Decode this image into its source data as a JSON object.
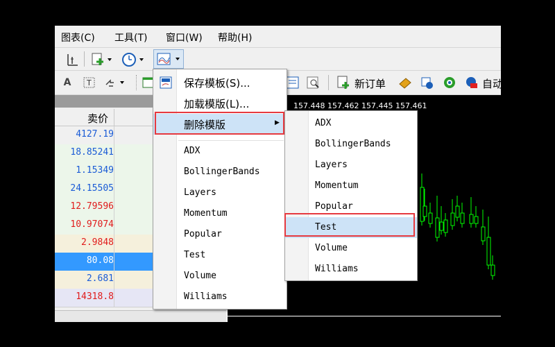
{
  "menubar": {
    "items": [
      "图表(C)",
      "工具(T)",
      "窗口(W)",
      "帮助(H)"
    ]
  },
  "toolbar2": {
    "new_order_label": "新订单",
    "auto_label": "自动"
  },
  "market_watch": {
    "column_header": "卖价",
    "rows": [
      {
        "value": "4127.19",
        "color": "#1a5bd6",
        "bg": "#f0f0f0"
      },
      {
        "value": "18.85241",
        "color": "#1a5bd6",
        "bg": "#ecf6ea"
      },
      {
        "value": "1.15349",
        "color": "#1a5bd6",
        "bg": "#ecf6ea"
      },
      {
        "value": "24.15505",
        "color": "#1a5bd6",
        "bg": "#ecf6ea"
      },
      {
        "value": "12.79596",
        "color": "#e01b1b",
        "bg": "#ecf6ea"
      },
      {
        "value": "10.97074",
        "color": "#e01b1b",
        "bg": "#ecf6ea"
      },
      {
        "value": "2.9848",
        "color": "#e01b1b",
        "bg": "#f5f0dc"
      },
      {
        "value": "80.08",
        "color": "#ffffff",
        "bg": "#3399ff"
      },
      {
        "value": "2.681",
        "color": "#1a5bd6",
        "bg": "#f5f0dc"
      },
      {
        "value": "14318.8",
        "color": "#e01b1b",
        "bg": "#e6e6f5"
      }
    ]
  },
  "chart": {
    "quote": "157.448 157.462 157.445 157.461"
  },
  "template_menu": {
    "save": "保存模板(S)...",
    "load": "加载模版(L)...",
    "delete": "删除模版",
    "templates": [
      "ADX",
      "BollingerBands",
      "Layers",
      "Momentum",
      "Popular",
      "Test",
      "Volume",
      "Williams"
    ]
  },
  "delete_submenu": {
    "templates": [
      "ADX",
      "BollingerBands",
      "Layers",
      "Momentum",
      "Popular",
      "Test",
      "Volume",
      "Williams"
    ],
    "highlighted": "Test"
  },
  "colors": {
    "highlight_border": "#e6393f",
    "bull_candle": "#00ff00",
    "selection": "#3399ff"
  }
}
